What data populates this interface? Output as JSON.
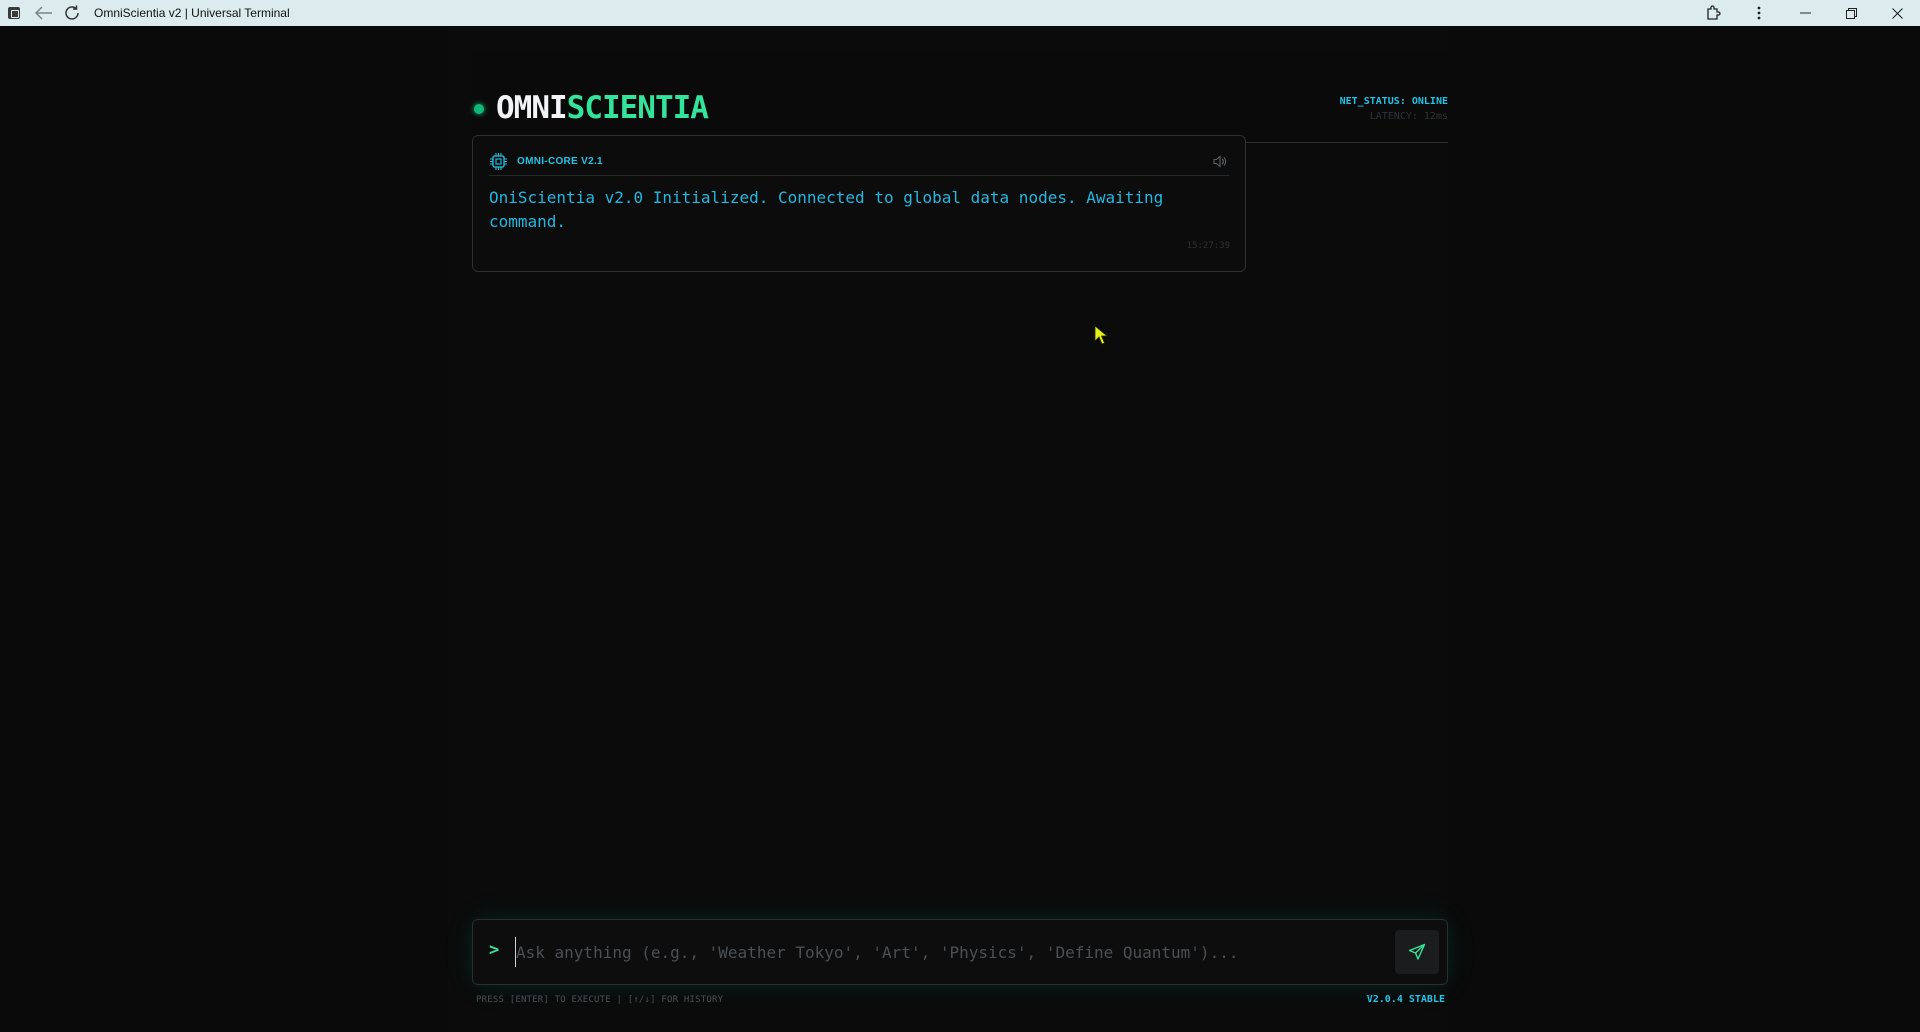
{
  "window": {
    "title": "OmniScientia v2 | Universal Terminal"
  },
  "header": {
    "logo_part1": "OMNI",
    "logo_part2": "SCIENTIA",
    "net_status": "NET_STATUS: ONLINE",
    "latency": "LATENCY: 12ms"
  },
  "messages": [
    {
      "source": "OMNI-CORE V2.1",
      "text": "OniScientia v2.0 Initialized. Connected to global data nodes. Awaiting command.",
      "time": "15:27:39"
    }
  ],
  "input": {
    "prompt": ">",
    "placeholder": "Ask anything (e.g., 'Weather Tokyo', 'Art', 'Physics', 'Define Quantum')...",
    "value": ""
  },
  "footer": {
    "hint": "PRESS [ENTER] TO EXECUTE | [↑/↓] FOR HISTORY",
    "version": "V2.0.4 STABLE"
  },
  "colors": {
    "accent_green": "#34e39c",
    "accent_cyan": "#22c3e6",
    "background": "#0a0a0a",
    "titlebar": "#dcecee"
  }
}
